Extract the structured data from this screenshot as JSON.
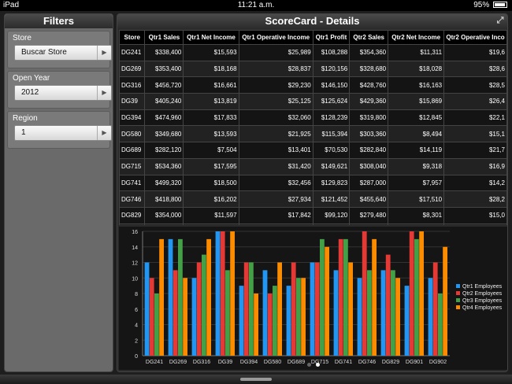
{
  "statusbar": {
    "device": "iPad",
    "time": "11:21 a.m.",
    "battery": "95%"
  },
  "filters": {
    "title": "Filters",
    "groups": [
      {
        "label": "Store",
        "value": "Buscar Store"
      },
      {
        "label": "Open Year",
        "value": "2012"
      },
      {
        "label": "Region",
        "value": "1"
      }
    ]
  },
  "panel": {
    "title": "ScoreCard - Details"
  },
  "table": {
    "headers": [
      "Store",
      "Qtr1 Sales",
      "Qtr1 Net Income",
      "Qtr1 Operative Income",
      "Qtr1 Profit",
      "Qtr2 Sales",
      "Qtr2 Net Income",
      "Qtr2 Operative Inco"
    ],
    "rows": [
      [
        "DG241",
        "$338,400",
        "$15,593",
        "$25,989",
        "$108,288",
        "$354,360",
        "$11,311",
        "$19,6"
      ],
      [
        "DG269",
        "$353,400",
        "$18,168",
        "$28,837",
        "$120,156",
        "$328,680",
        "$18,028",
        "$28,6"
      ],
      [
        "DG316",
        "$456,720",
        "$16,661",
        "$29,230",
        "$146,150",
        "$428,760",
        "$16,163",
        "$28,5"
      ],
      [
        "DG39",
        "$405,240",
        "$13,819",
        "$25,125",
        "$125,624",
        "$429,360",
        "$15,869",
        "$26,4"
      ],
      [
        "DG394",
        "$474,960",
        "$17,833",
        "$32,060",
        "$128,239",
        "$319,800",
        "$12,845",
        "$22,1"
      ],
      [
        "DG580",
        "$349,680",
        "$13,593",
        "$21,925",
        "$115,394",
        "$303,360",
        "$8,494",
        "$15,1"
      ],
      [
        "DG689",
        "$282,120",
        "$7,504",
        "$13,401",
        "$70,530",
        "$282,840",
        "$14,119",
        "$21,7"
      ],
      [
        "DG715",
        "$534,360",
        "$17,595",
        "$31,420",
        "$149,621",
        "$308,040",
        "$9,318",
        "$16,9"
      ],
      [
        "DG741",
        "$499,320",
        "$18,500",
        "$32,456",
        "$129,823",
        "$287,000",
        "$7,957",
        "$14,2"
      ],
      [
        "DG746",
        "$418,800",
        "$16,202",
        "$27,934",
        "$121,452",
        "$455,640",
        "$17,510",
        "$28,2"
      ],
      [
        "DG829",
        "$354,000",
        "$11,597",
        "$17,842",
        "$99,120",
        "$279,480",
        "$8,301",
        "$15,0"
      ],
      [
        "",
        "",
        "",
        "",
        "",
        "",
        "",
        ""
      ]
    ]
  },
  "chart_data": {
    "type": "bar",
    "categories": [
      "DG241",
      "DG269",
      "DG316",
      "DG39",
      "DG394",
      "DG580",
      "DG689",
      "DG715",
      "DG741",
      "DG746",
      "DG829",
      "DG901",
      "DG902"
    ],
    "series": [
      {
        "name": "Qtr1 Employees",
        "color": "#2196f3",
        "values": [
          12,
          15,
          10,
          16,
          9,
          11,
          9,
          12,
          11,
          10,
          11,
          9,
          10
        ]
      },
      {
        "name": "Qtr2 Employees",
        "color": "#e53935",
        "values": [
          10,
          11,
          12,
          16,
          12,
          8,
          12,
          12,
          15,
          16,
          13,
          16,
          12
        ]
      },
      {
        "name": "Qtr3 Employees",
        "color": "#43a047",
        "values": [
          8,
          15,
          13,
          11,
          12,
          9,
          10,
          15,
          15,
          11,
          11,
          15,
          8
        ]
      },
      {
        "name": "Qtr4 Employees",
        "color": "#fb8c00",
        "values": [
          15,
          10,
          15,
          16,
          8,
          12,
          10,
          14,
          12,
          15,
          10,
          16,
          14
        ]
      }
    ],
    "ylim": [
      0,
      16
    ],
    "yticks": [
      "0",
      "2",
      "4",
      "6",
      "8",
      "10",
      "12",
      "14",
      "16"
    ],
    "legend_position": "right",
    "grid": true
  },
  "pager": {
    "pages": 2,
    "active": 1
  }
}
